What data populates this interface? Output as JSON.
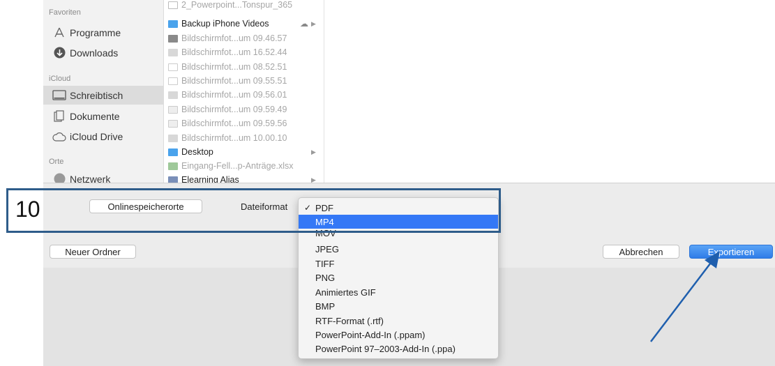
{
  "sidebar": {
    "favorites_title": "Favoriten",
    "favorites": [
      {
        "label": "Programme",
        "icon": "programs-icon"
      },
      {
        "label": "Downloads",
        "icon": "downloads-icon"
      }
    ],
    "icloud_title": "iCloud",
    "icloud": [
      {
        "label": "Schreibtisch",
        "icon": "desktop-icon",
        "selected": true
      },
      {
        "label": "Dokumente",
        "icon": "documents-icon"
      },
      {
        "label": "iCloud Drive",
        "icon": "cloud-icon"
      }
    ],
    "places_title": "Orte",
    "places": [
      {
        "label": "Netzwerk",
        "icon": "network-icon"
      }
    ]
  },
  "files": [
    {
      "name": "2_Powerpoint...Tonspur_365",
      "type": "doc",
      "dim": true
    },
    {
      "name": "Backup iPhone Videos",
      "type": "folder",
      "dim": false
    },
    {
      "name": "Bildschirmfot...um 09.46.57",
      "type": "image",
      "dim": true
    },
    {
      "name": "Bildschirmfot...um 16.52.44",
      "type": "image",
      "dim": true
    },
    {
      "name": "Bildschirmfot...um 08.52.51",
      "type": "image",
      "dim": true
    },
    {
      "name": "Bildschirmfot...um 09.55.51",
      "type": "image",
      "dim": true
    },
    {
      "name": "Bildschirmfot...um 09.56.01",
      "type": "image",
      "dim": true
    },
    {
      "name": "Bildschirmfot...um 09.59.49",
      "type": "image",
      "dim": true
    },
    {
      "name": "Bildschirmfot...um 09.59.56",
      "type": "image",
      "dim": true
    },
    {
      "name": "Bildschirmfot...um 10.00.10",
      "type": "image",
      "dim": true
    },
    {
      "name": "Desktop",
      "type": "folder",
      "dim": false
    },
    {
      "name": "Eingang-Fell...p-Anträge.xlsx",
      "type": "excel",
      "dim": true
    },
    {
      "name": "Elearning Alias",
      "type": "alias",
      "dim": false
    }
  ],
  "toolbar": {
    "online_locations_label": "Onlinespeicherorte",
    "format_label": "Dateiformat",
    "new_folder_label": "Neuer Ordner",
    "cancel_label": "Abbrechen",
    "export_label": "Exportieren"
  },
  "format_menu": {
    "selected": "PDF",
    "highlighted": "MP4",
    "checkmark": "✓",
    "options": [
      "PDF",
      "MP4",
      "MOV",
      "JPEG",
      "TIFF",
      "PNG",
      "Animiertes GIF",
      "BMP",
      "RTF-Format (.rtf)",
      "PowerPoint-Add-In (.ppam)",
      "PowerPoint 97–2003-Add-In (.ppa)"
    ]
  },
  "annotation": {
    "step_number": "10"
  },
  "colors": {
    "accent": "#3478f6",
    "annotation": "#2e5c8a",
    "folder": "#4aa3ec",
    "arrow": "#1f5fae"
  }
}
